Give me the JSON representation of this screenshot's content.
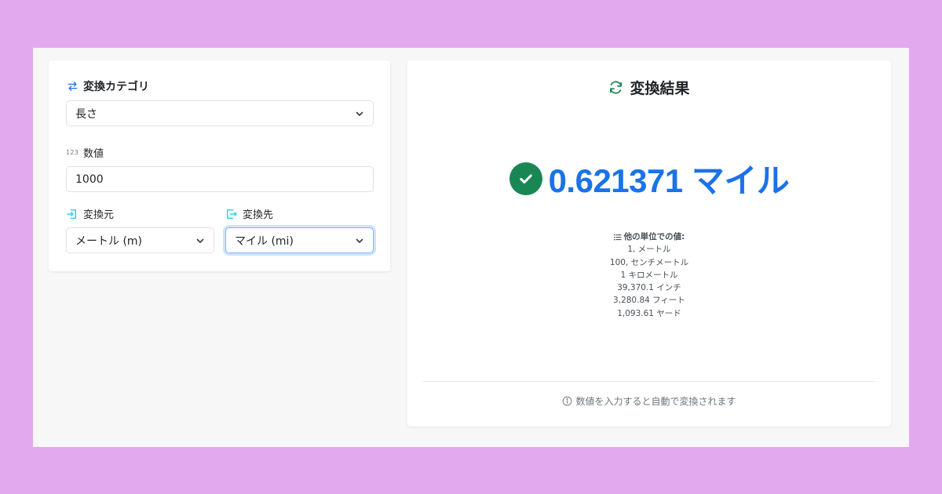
{
  "form": {
    "category_label": "変換カテゴリ",
    "category_value": "長さ",
    "number_label": "数値",
    "number_icon_text": "123",
    "number_value": "1000",
    "from_label": "変換元",
    "from_value": "メートル (m)",
    "to_label": "変換先",
    "to_value": "マイル (mi)"
  },
  "result": {
    "title": "変換結果",
    "value": "0.621371 マイル",
    "other_title": "他の単位での値:",
    "other_values": [
      "1, メートル",
      "100, センチメートル",
      "1 キロメートル",
      "39,370.1 インチ",
      "3,280.84 フィート",
      "1,093.61 ヤード"
    ],
    "footer_note": "数値を入力すると自動で変換されます"
  },
  "colors": {
    "background": "#e2a9ef",
    "accent_blue": "#1a73e8",
    "success_green": "#198754"
  },
  "icons": {
    "category": "arrows-exchange-icon",
    "number": "123-icon",
    "from": "box-arrow-in-icon",
    "to": "box-arrow-out-icon",
    "result": "arrow-repeat-icon",
    "check": "check-circle-icon",
    "list": "list-icon",
    "info": "info-circle-icon"
  }
}
